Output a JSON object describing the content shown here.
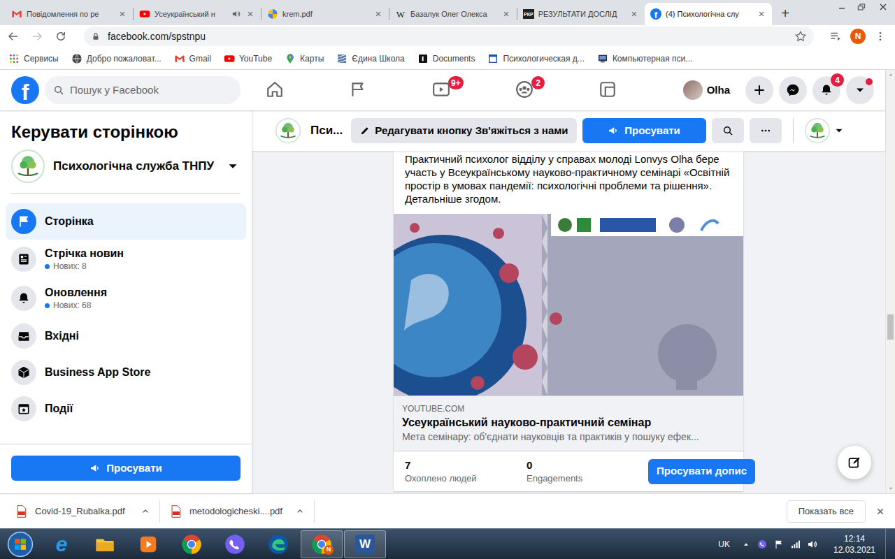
{
  "browser": {
    "tabs": [
      {
        "label": "Повідомлення по ре",
        "kind": "gmail",
        "audio": false,
        "selected": false
      },
      {
        "label": "Усеукраїнський н",
        "kind": "youtube",
        "audio": true,
        "selected": false
      },
      {
        "label": "krem.pdf",
        "kind": "drive",
        "audio": false,
        "selected": false
      },
      {
        "label": "Базалук Олег Олекса",
        "kind": "wiki",
        "icon_text": "W",
        "audio": false,
        "selected": false
      },
      {
        "label": "РЕЗУЛЬТАТИ ДОСЛІД",
        "kind": "pkp",
        "icon_text": "РКР",
        "audio": false,
        "selected": false
      },
      {
        "label": "(4) Психологічна слу",
        "kind": "facebook",
        "icon_text": "f",
        "audio": false,
        "selected": true
      }
    ],
    "new_tab": "+",
    "url": "facebook.com/spstnpu",
    "profile_initial": "N",
    "bookmarks": [
      {
        "label": "Сервисы",
        "kind": "apps"
      },
      {
        "label": "Добро пожаловат...",
        "kind": "globe"
      },
      {
        "label": "Gmail",
        "kind": "gmail"
      },
      {
        "label": "YouTube",
        "kind": "youtube"
      },
      {
        "label": "Карты",
        "kind": "maps"
      },
      {
        "label": "Єдина Школа",
        "kind": "school"
      },
      {
        "label": "Documents",
        "kind": "docs"
      },
      {
        "label": "Психологическая д...",
        "kind": "psych"
      },
      {
        "label": "Компьютерная пси...",
        "kind": "comp"
      }
    ]
  },
  "facebook": {
    "logo": "f",
    "search_placeholder": "Пошук у Facebook",
    "nav": [
      {
        "kind": "home",
        "selected": false
      },
      {
        "kind": "pages",
        "selected": false
      },
      {
        "kind": "watch",
        "badge": "9+",
        "selected": false
      },
      {
        "kind": "groups",
        "badge": "2",
        "selected": false
      },
      {
        "kind": "gaming",
        "selected": false
      }
    ],
    "profile_name": "Olha",
    "actions": [
      {
        "kind": "create"
      },
      {
        "kind": "messenger"
      },
      {
        "kind": "notifications",
        "badge": "4"
      },
      {
        "kind": "account",
        "dot": true
      }
    ],
    "sidebar": {
      "title": "Керувати сторінкою",
      "page_name": "Психологічна служба ТНПУ",
      "items": [
        {
          "label": "Сторінка",
          "kind": "page",
          "selected": true
        },
        {
          "label": "Стрічка новин",
          "kind": "feed",
          "sub": "Нових: 8",
          "selected": false
        },
        {
          "label": "Оновлення",
          "kind": "updates",
          "sub": "Нових: 68",
          "selected": false
        },
        {
          "label": "Вхідні",
          "kind": "inbox",
          "selected": false
        },
        {
          "label": "Business App Store",
          "kind": "store",
          "selected": false
        },
        {
          "label": "Події",
          "kind": "events",
          "selected": false
        }
      ],
      "promote_button": "Просувати"
    },
    "page_header": {
      "name": "Пси...",
      "edit_button": "Редагувати кнопку Зв'яжіться з нами",
      "promote_button": "Просувати"
    },
    "post": {
      "text": "Практичний психолог відділу у справах молоді Lonvys Olha бере участь у Всеукраїнському науково-практичному семінарі «Освітній простір в умовах пандемії: психологічні проблеми та рішення». Детальніше згодом.",
      "link": {
        "domain": "YOUTUBE.COM",
        "title": "Усеукраїнський науково-практичний семінар",
        "description": "Мета семінару: об'єднати науковців та практиків у пошуку ефек..."
      },
      "stats": [
        {
          "value": "7",
          "label": "Охоплено людей"
        },
        {
          "value": "0",
          "label": "Engagements"
        }
      ],
      "promote_button": "Просувати допис"
    },
    "scrollbar": {
      "position": 0.62
    }
  },
  "downloads": {
    "files": [
      {
        "name": "Covid-19_Rubalka.pdf"
      },
      {
        "name": "metodologicheski....pdf"
      }
    ],
    "show_all": "Показать все"
  },
  "taskbar": {
    "apps": [
      {
        "kind": "ie",
        "text": "e",
        "active": false
      },
      {
        "kind": "explorer",
        "active": false
      },
      {
        "kind": "media",
        "active": false
      },
      {
        "kind": "chrome",
        "active": false
      },
      {
        "kind": "viber",
        "active": false
      },
      {
        "kind": "edge",
        "active": false
      },
      {
        "kind": "chrome",
        "badge": "N",
        "active": true
      },
      {
        "kind": "word",
        "text": "W",
        "active": true
      }
    ],
    "language": "UK",
    "time": "12:14",
    "date": "12.03.2021"
  }
}
